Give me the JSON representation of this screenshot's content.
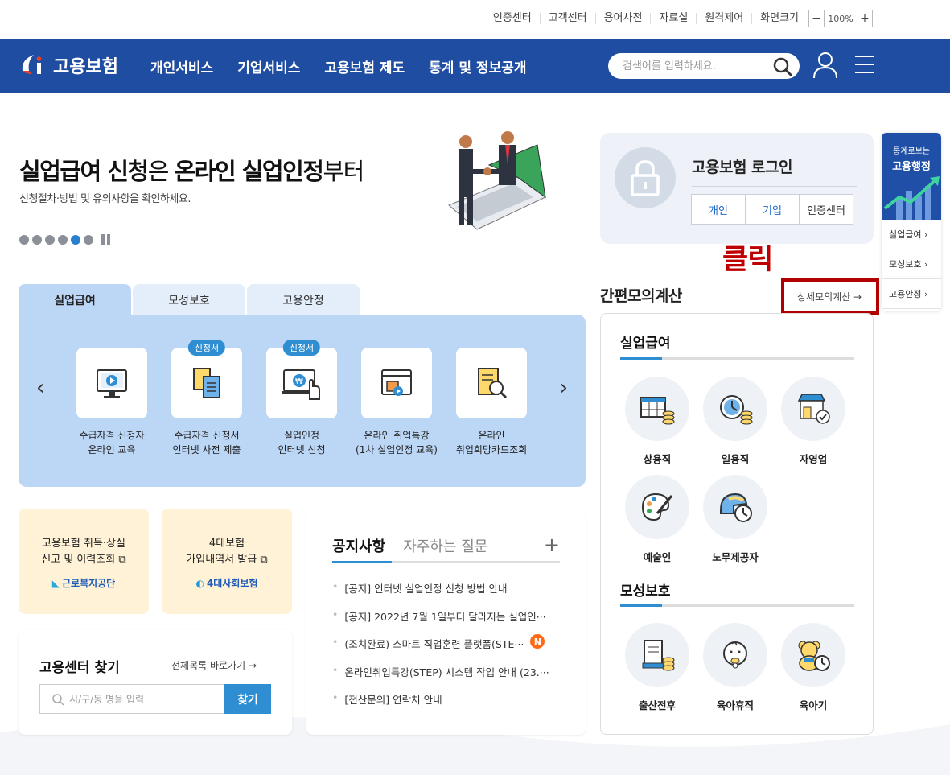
{
  "util": {
    "links": [
      "인증센터",
      "고객센터",
      "용어사전",
      "자료실",
      "원격제어",
      "화면크기"
    ],
    "zoom_minus": "−",
    "zoom_value": "100%",
    "zoom_plus": "+"
  },
  "header": {
    "logo_text": "고용보험",
    "nav": [
      "개인서비스",
      "기업서비스",
      "고용보험 제도",
      "통계 및 정보공개"
    ],
    "search_placeholder": "검색어를 입력하세요.",
    "icons": [
      "search-icon",
      "user-icon",
      "menu-icon"
    ],
    "bg_color": "#1e4da1"
  },
  "hero": {
    "title_part1": "실업급여 신청",
    "title_part2": "은 ",
    "title_part3": "온라인 실업인정",
    "title_part4": "부터",
    "subtitle": "신청절차·방법 및 유의사항을 확인하세요.",
    "slide_count": 6,
    "active_slide": 5
  },
  "login": {
    "title": "고용보험 로그인",
    "buttons": [
      "개인",
      "기업",
      "인증센터"
    ]
  },
  "quick": {
    "label_small": "통계로보는",
    "label_big": "고용행정",
    "items": [
      "실업급여 ›",
      "모성보호 ›",
      "고용안정 ›"
    ]
  },
  "annotation": {
    "click_text": "클릭",
    "color": "#c00000"
  },
  "tabs": [
    "실업급여",
    "모성보호",
    "고용안정"
  ],
  "services": [
    {
      "tag": "",
      "line1": "수급자격 신청자",
      "line2": "온라인 교육"
    },
    {
      "tag": "신청서",
      "line1": "수급자격 신청서",
      "line2": "인터넷 사전 제출"
    },
    {
      "tag": "신청서",
      "line1": "실업인정",
      "line2": "인터넷 신청"
    },
    {
      "tag": "",
      "line1": "온라인 취업특강",
      "line2": "(1차 실업인정 교육)"
    },
    {
      "tag": "",
      "line1": "온라인",
      "line2": "취업희망카드조회"
    }
  ],
  "boxes": [
    {
      "line1": "고용보험 취득·상실",
      "line2": "신고 및 이력조회",
      "org": "근로복지공단"
    },
    {
      "line1": "4대보험",
      "line2": "가입내역서 발급",
      "org": "4대사회보험"
    }
  ],
  "center": {
    "title": "고용센터 찾기",
    "link": "전체목록 바로가기 →",
    "placeholder": "시/구/동 명을 입력",
    "button": "찾기"
  },
  "notice": {
    "tab_active": "공지사항",
    "tab_other": "자주하는 질문",
    "plus": "+",
    "items": [
      "[공지] 인터넷 실업인정 신청 방법 안내",
      "[공지] 2022년 7월 1일부터 달라지는 실업인···",
      "(조치완료) 스마트 직업훈련 플랫폼(STE···",
      "온라인취업특강(STEP) 시스템 작업 안내 (23.···",
      "[전산문의] 연락처 안내"
    ],
    "new_badge": "N"
  },
  "calc": {
    "title": "간편모의계산",
    "link": "상세모의계산 →",
    "section1": "실업급여",
    "items1": [
      "상용직",
      "일용직",
      "자영업",
      "예술인",
      "노무제공자"
    ],
    "section2": "모성보호",
    "items2": [
      "출산전후",
      "육아휴직",
      "육아기"
    ]
  },
  "colors": {
    "accent": "#2f8dd2",
    "panel": "#bcd6f6",
    "tab_inactive": "#e4eefb",
    "box_yellow": "#fff2d6"
  }
}
